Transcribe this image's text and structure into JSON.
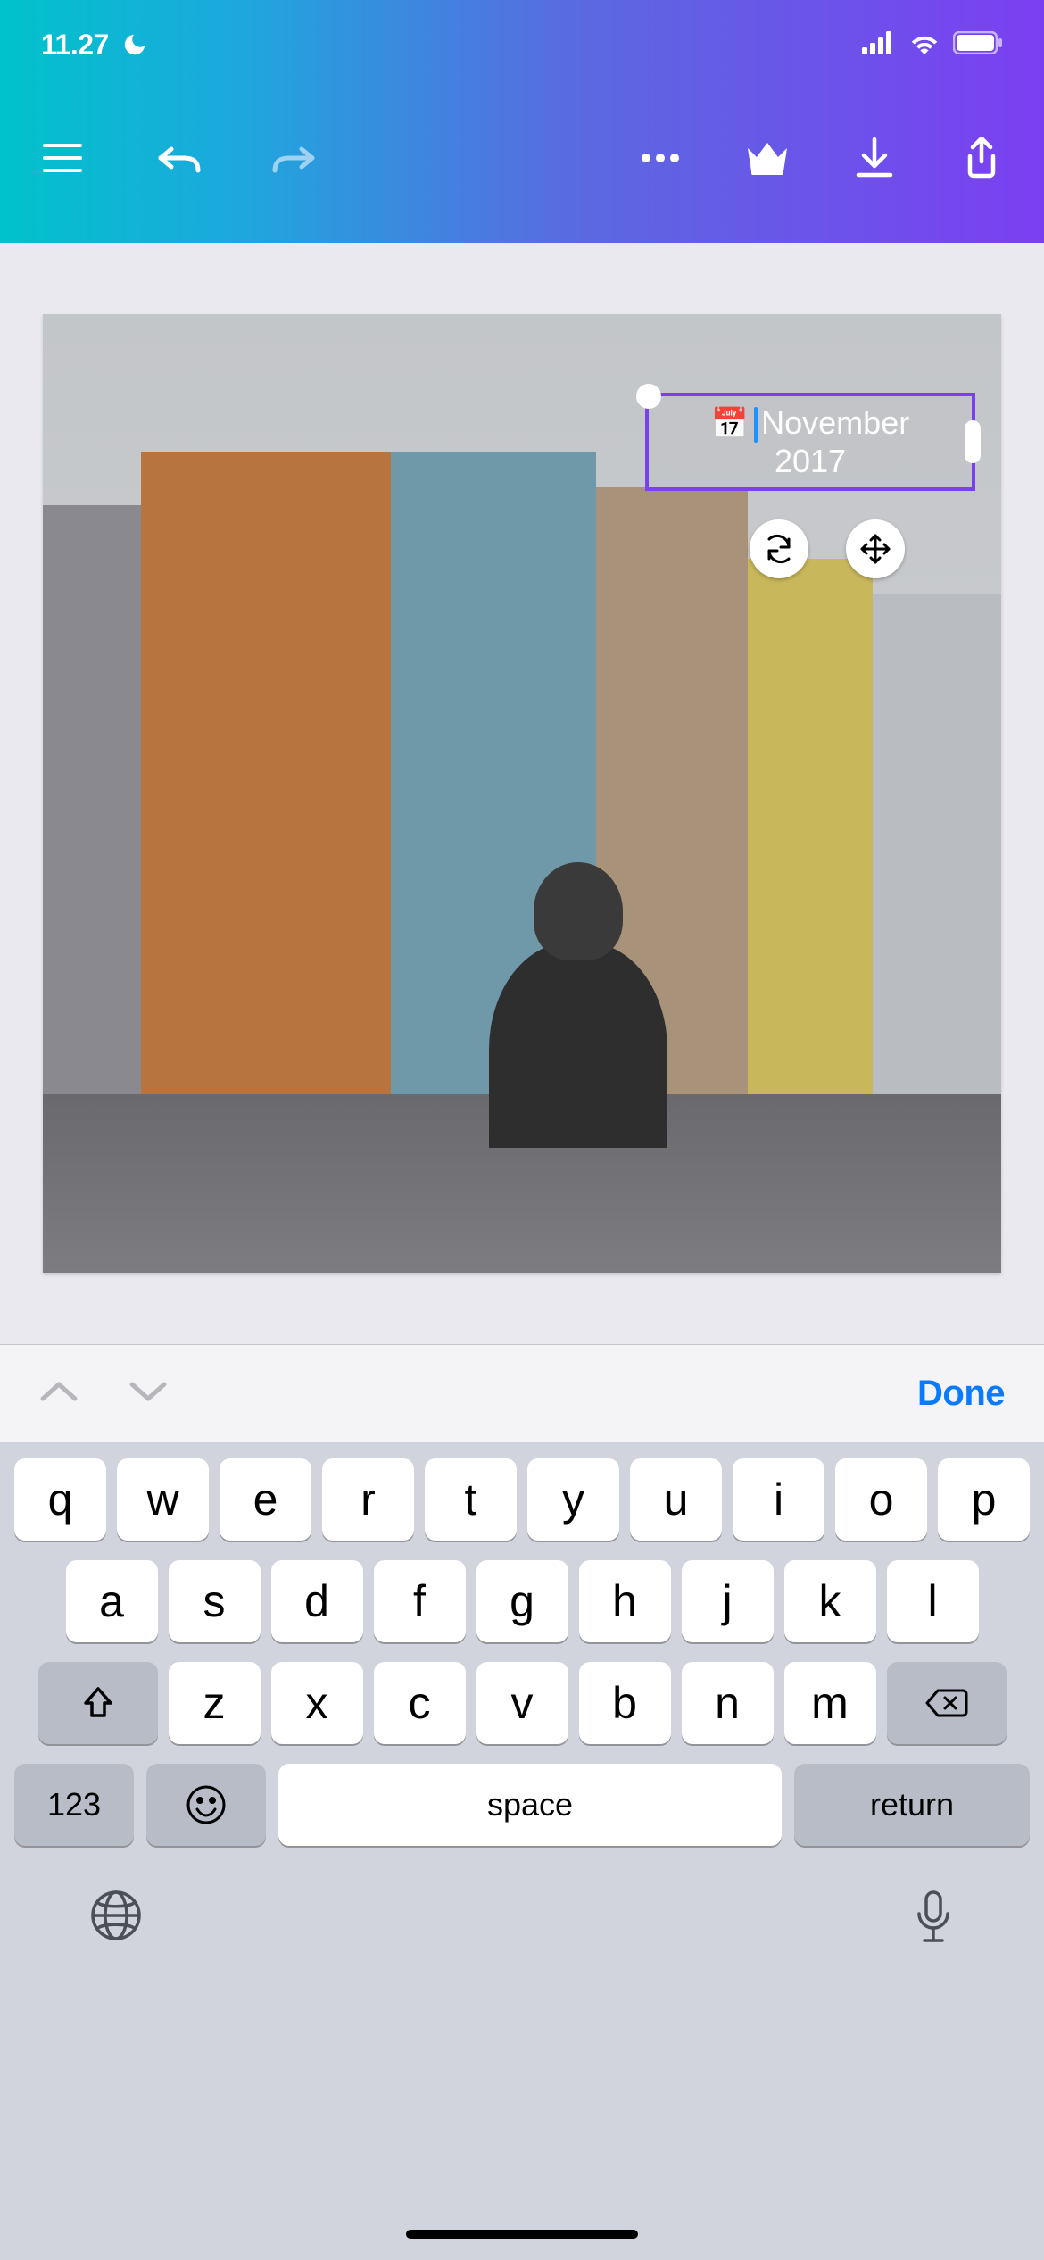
{
  "status_bar": {
    "time": "11.27",
    "moon_icon": "moon-icon",
    "signal_icon": "cellular-signal-icon",
    "wifi_icon": "wifi-icon",
    "battery_icon": "battery-icon"
  },
  "toolbar": {
    "menu_icon": "hamburger-menu-icon",
    "undo_icon": "undo-icon",
    "redo_icon": "redo-icon",
    "more_icon": "more-options-icon",
    "crown_icon": "premium-crown-icon",
    "download_icon": "download-icon",
    "share_icon": "share-icon"
  },
  "canvas": {
    "text_element": {
      "icon": "📅",
      "line1": "November",
      "line2": "2017"
    },
    "rotate_icon": "rotate-icon",
    "move_icon": "move-icon"
  },
  "keyboard_accessory": {
    "prev_icon": "chevron-up-icon",
    "next_icon": "chevron-down-icon",
    "done_label": "Done"
  },
  "keyboard": {
    "row1": [
      "q",
      "w",
      "e",
      "r",
      "t",
      "y",
      "u",
      "i",
      "o",
      "p"
    ],
    "row2": [
      "a",
      "s",
      "d",
      "f",
      "g",
      "h",
      "j",
      "k",
      "l"
    ],
    "row3": [
      "z",
      "x",
      "c",
      "v",
      "b",
      "n",
      "m"
    ],
    "shift_icon": "shift-icon",
    "backspace_icon": "backspace-icon",
    "numbers_label": "123",
    "emoji_icon": "emoji-icon",
    "space_label": "space",
    "return_label": "return",
    "globe_icon": "globe-icon",
    "mic_icon": "microphone-icon"
  }
}
